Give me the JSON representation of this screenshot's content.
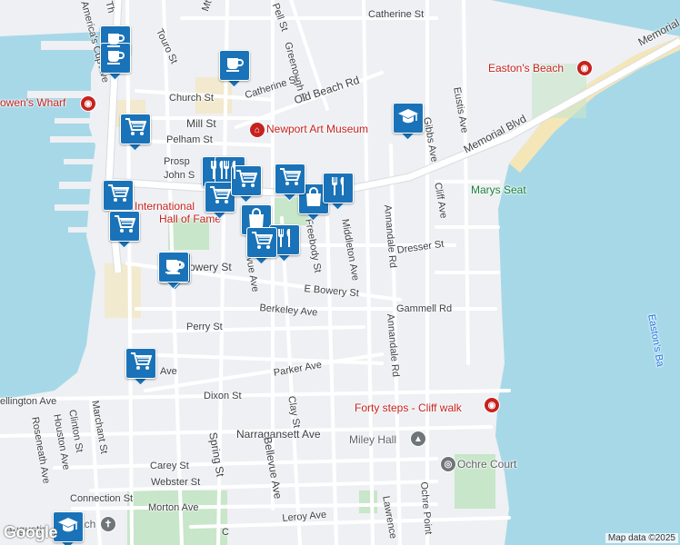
{
  "streets": [
    {
      "text": "Catherine St"
    },
    {
      "text": "Pell St"
    },
    {
      "text": "Touro St"
    },
    {
      "text": "Mt Vernon St"
    },
    {
      "text": "Greenough Pl"
    },
    {
      "text": "Old Beach Rd"
    },
    {
      "text": "Church St"
    },
    {
      "text": "Catherine St"
    },
    {
      "text": "Mill St"
    },
    {
      "text": "Pelham St"
    },
    {
      "text": "Prosp"
    },
    {
      "text": "John S"
    },
    {
      "text": "Memorial Blvd"
    },
    {
      "text": "Memorial"
    },
    {
      "text": "Eustis Ave"
    },
    {
      "text": "Gibbs Ave"
    },
    {
      "text": "Cliff Ave"
    },
    {
      "text": "Annandale Rd"
    },
    {
      "text": "Annandale Rd"
    },
    {
      "text": "Middleton Ave"
    },
    {
      "text": "Freebody St"
    },
    {
      "text": "Dresser St"
    },
    {
      "text": "Bowery St"
    },
    {
      "text": "E Bowery St"
    },
    {
      "text": "Gammell Rd"
    },
    {
      "text": "Berkeley Ave"
    },
    {
      "text": "Perry St"
    },
    {
      "text": "Parker Ave"
    },
    {
      "text": "Dixon St"
    },
    {
      "text": "Ave"
    },
    {
      "text": "ellington Ave"
    },
    {
      "text": "Clay St"
    },
    {
      "text": "Narragansett Ave"
    },
    {
      "text": "Carey St"
    },
    {
      "text": "Webster St"
    },
    {
      "text": "Connection St"
    },
    {
      "text": "Morton Ave"
    },
    {
      "text": "Leroy Ave"
    },
    {
      "text": "Spring St"
    },
    {
      "text": "Bellevue Ave"
    },
    {
      "text": "vue Ave"
    },
    {
      "text": "Marchant St"
    },
    {
      "text": "Clinton St"
    },
    {
      "text": "Houston Ave"
    },
    {
      "text": "Roseneath Ave"
    },
    {
      "text": "Lawrence"
    },
    {
      "text": "Ochre Point"
    },
    {
      "text": "America's Cup Ave"
    },
    {
      "text": "Th"
    },
    {
      "text": "C"
    },
    {
      "text": "Easton's Ba"
    }
  ],
  "places": [
    {
      "text": "Easton's Beach",
      "color": "#c5221f"
    },
    {
      "text": "Newport Art Museum",
      "color": "#c5221f"
    },
    {
      "text": "owen's Wharf",
      "color": "#c5221f"
    },
    {
      "text": "Marys Seat",
      "color": "#188038"
    },
    {
      "text": "International",
      "color": "#c5221f"
    },
    {
      "text": "Hall of Fame",
      "color": "#c5221f"
    },
    {
      "text": "Forty steps - Cliff walk",
      "color": "#c5221f"
    },
    {
      "text": "Miley Hall",
      "color": "#5f6368"
    },
    {
      "text": "Ochre Court",
      "color": "#5f6368"
    },
    {
      "text": "Augustin",
      "color": "#5f6368"
    },
    {
      "text": "ach",
      "color": "#5f6368"
    }
  ],
  "markers": [
    {
      "icon": "coffee-icon"
    },
    {
      "icon": "coffee-icon"
    },
    {
      "icon": "coffee-icon"
    },
    {
      "icon": "coffee-icon"
    },
    {
      "icon": "graduation-cap-icon"
    },
    {
      "icon": "shopping-cart-icon"
    },
    {
      "icon": "shopping-cart-icon"
    },
    {
      "icon": "shopping-cart-icon"
    },
    {
      "icon": "restaurant-icon"
    },
    {
      "icon": "restaurant-icon"
    },
    {
      "icon": "shopping-cart-icon"
    },
    {
      "icon": "shopping-bag-icon"
    },
    {
      "icon": "restaurant-icon"
    },
    {
      "icon": "shopping-cart-icon"
    },
    {
      "icon": "shopping-bag-icon"
    },
    {
      "icon": "shopping-cart-icon"
    },
    {
      "icon": "restaurant-icon"
    },
    {
      "icon": "shopping-cart-icon"
    },
    {
      "icon": "coffee-icon"
    },
    {
      "icon": "shopping-cart-icon"
    },
    {
      "icon": "graduation-cap-icon"
    }
  ],
  "attribution": "Map data ©2025",
  "logo": "Google",
  "colors": {
    "water": "#a7d8e8",
    "land": "#eef0f3",
    "park": "#c8e6c9",
    "beach": "#f5e6b8",
    "marker": "#1a73b8"
  }
}
